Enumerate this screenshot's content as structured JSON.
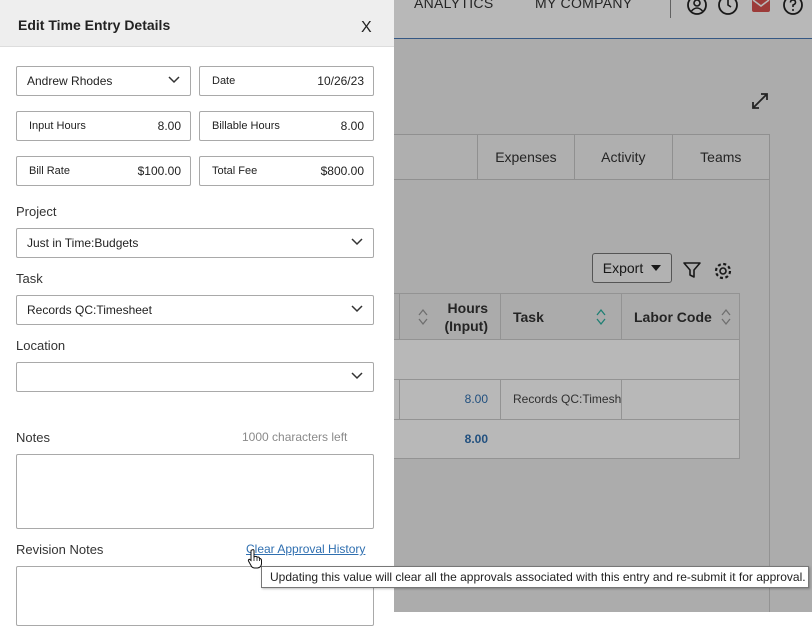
{
  "topnav": {
    "items": [
      "ANALYTICS",
      "MY COMPANY"
    ]
  },
  "tabs": [
    "",
    "Expenses",
    "Activity",
    "Teams"
  ],
  "toolbar": {
    "export_label": "Export"
  },
  "table": {
    "headers": {
      "hours_input": "Hours (Input)",
      "task": "Task",
      "labor_code": "Labor Code"
    },
    "row1": {
      "hours": "8.00",
      "task": "Records QC:Timesh"
    },
    "total": {
      "hours": "8.00"
    }
  },
  "panel": {
    "title": "Edit Time Entry Details",
    "close_label": "X",
    "employee": "Andrew Rhodes",
    "date_label": "Date",
    "date_value": "10/26/23",
    "input_hours_label": "Input Hours",
    "input_hours_value": "8.00",
    "billable_hours_label": "Billable Hours",
    "billable_hours_value": "8.00",
    "bill_rate_label": "Bill Rate",
    "bill_rate_value": "$100.00",
    "total_fee_label": "Total Fee",
    "total_fee_value": "$800.00",
    "project_label": "Project",
    "project_value": "Just in Time:Budgets",
    "task_label": "Task",
    "task_value": "Records QC:Timesheet",
    "location_label": "Location",
    "location_value": "",
    "notes_label": "Notes",
    "notes_chars_left": "1000 characters left",
    "notes_value": "",
    "revision_notes_label": "Revision Notes",
    "clear_history_label": "Clear Approval History",
    "tooltip_text": "Updating this value will clear all the approvals associated with this entry and re-submit it for approval."
  },
  "colors": {
    "accent": "#2f6fb0",
    "header_bg": "#eeeeee",
    "link": "#2f6fb0",
    "mail_icon": "#d9534f"
  }
}
